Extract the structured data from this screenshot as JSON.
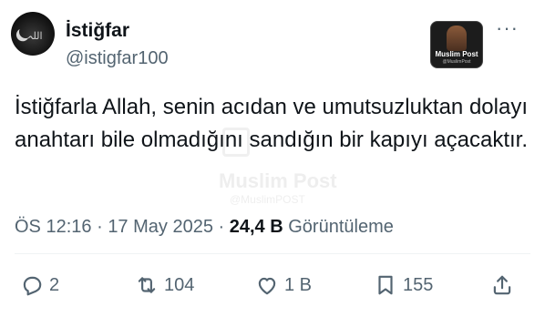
{
  "tweet": {
    "author_name": "İstiğfar",
    "author_handle": "@istigfar100",
    "text": "İstiğfarla Allah, senin acıdan ve umutsuzluktan dolayı anahtarı bile olmadığını sandığın bir kapıyı açacaktır.",
    "time": "ÖS 12:16",
    "separator": "·",
    "date": "17 May 2025",
    "views_count": "24,4 B",
    "views_label": "Görüntüleme"
  },
  "badge": {
    "logo_text": "Muslim Post",
    "logo_sub": "@MuslimPost"
  },
  "watermark": {
    "title": "Muslim Post",
    "sub": "@MuslimPOST"
  },
  "actions": {
    "replies": "2",
    "reposts": "104",
    "likes": "1 B",
    "bookmarks": "155"
  },
  "icons": {
    "more": "more-icon",
    "reply": "reply-icon",
    "repost": "repost-icon",
    "like": "heart-icon",
    "bookmark": "bookmark-icon",
    "share": "share-icon"
  },
  "colors": {
    "text": "#0f1419",
    "secondary": "#536471",
    "divider": "#eff3f4"
  }
}
